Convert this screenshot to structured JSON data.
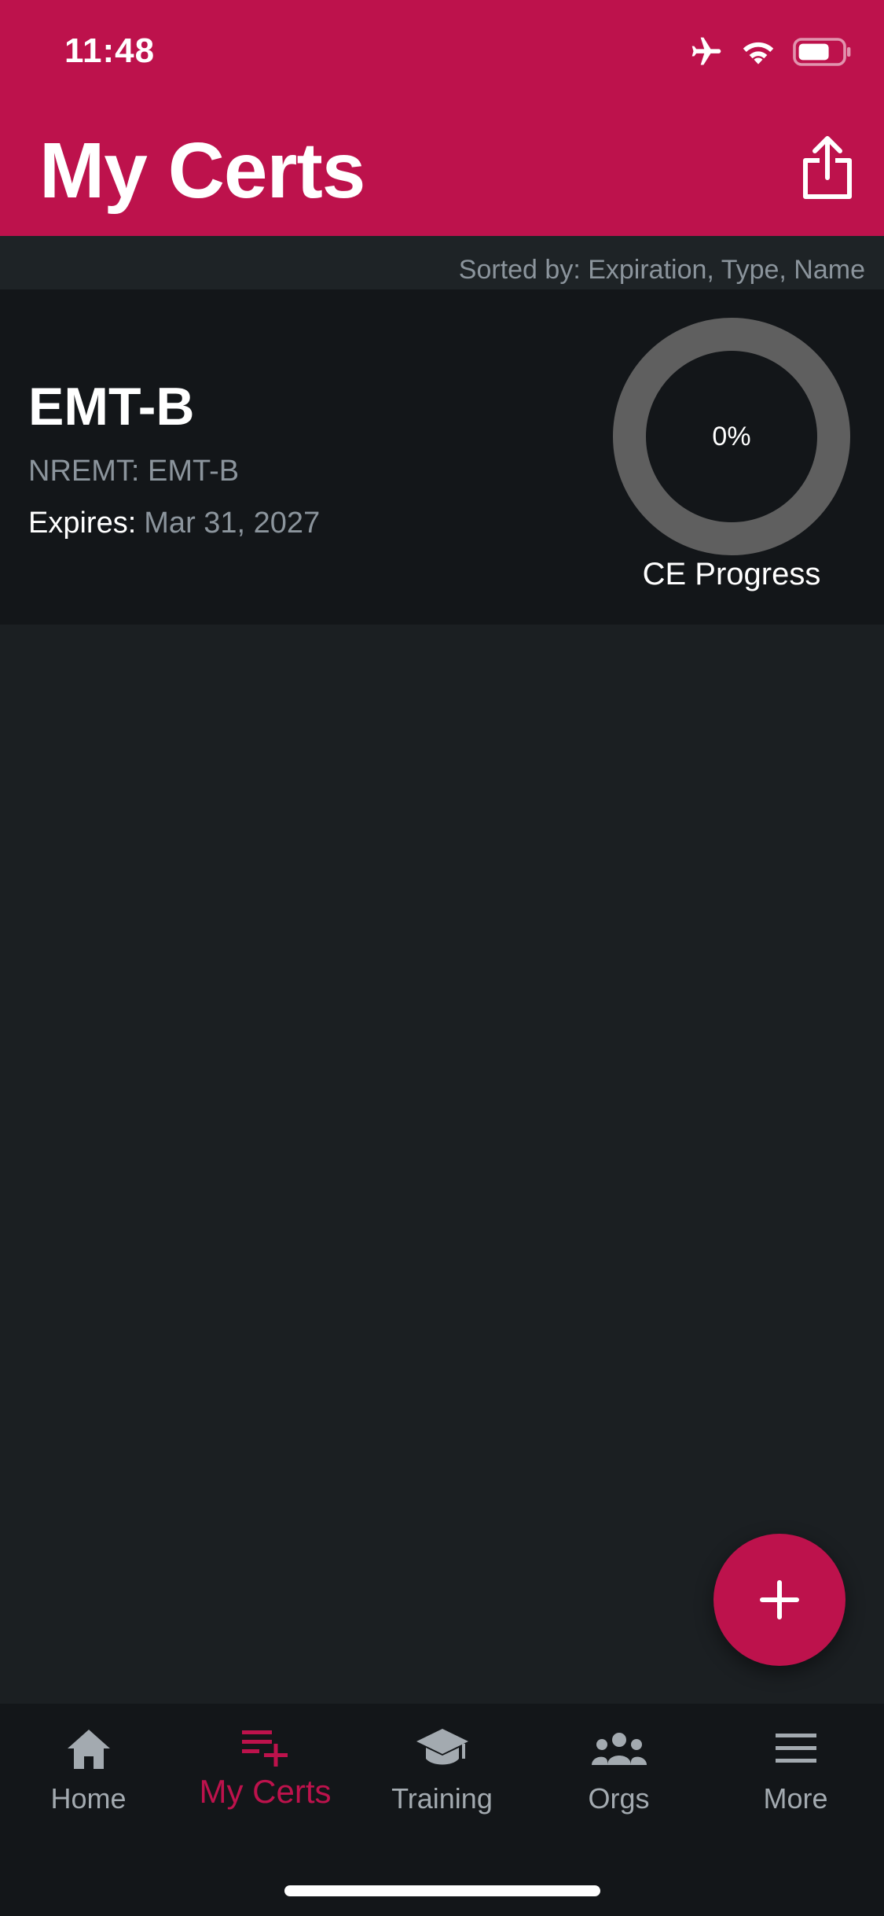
{
  "status_bar": {
    "time": "11:48"
  },
  "header": {
    "title": "My Certs"
  },
  "sort": {
    "label": "Sorted by: Expiration, Type, Name"
  },
  "cert": {
    "name": "EMT-B",
    "issuer_line": "NREMT: EMT-B",
    "expires_label": "Expires:",
    "expires_value": "Mar 31, 2027",
    "progress_percent": 0,
    "progress_text": "0%",
    "progress_label": "CE Progress"
  },
  "tabs": [
    {
      "label": "Home",
      "icon": "home-icon"
    },
    {
      "label": "My Certs",
      "icon": "list-add-icon",
      "active": true
    },
    {
      "label": "Training",
      "icon": "graduation-cap-icon"
    },
    {
      "label": "Orgs",
      "icon": "people-icon"
    },
    {
      "label": "More",
      "icon": "menu-icon"
    }
  ],
  "colors": {
    "brand": "#bd124c",
    "background": "#1b1f22",
    "card": "#131619",
    "muted": "#8b949c",
    "ring": "#5f5f5f"
  }
}
